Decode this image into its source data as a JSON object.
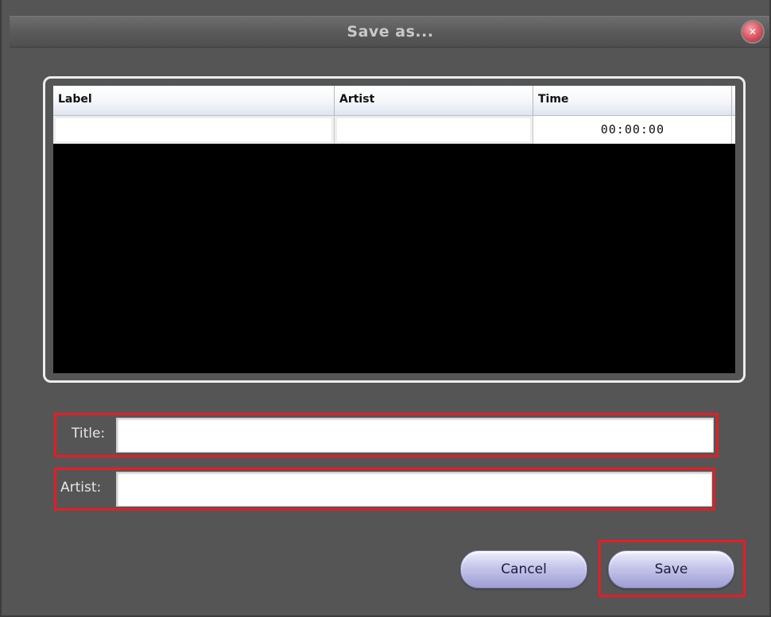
{
  "dialog": {
    "title": "Save as...",
    "close_icon": "close-icon",
    "accent_highlight": "#e81c24"
  },
  "table": {
    "columns": [
      "Label",
      "Artist",
      "Time"
    ],
    "rows": [
      {
        "label": "",
        "artist": "",
        "time": "00:00:00"
      }
    ]
  },
  "form": {
    "title_label": "Title:",
    "title_value": "",
    "artist_label": "Artist:",
    "artist_value": ""
  },
  "buttons": {
    "cancel_label": "Cancel",
    "save_label": "Save"
  }
}
